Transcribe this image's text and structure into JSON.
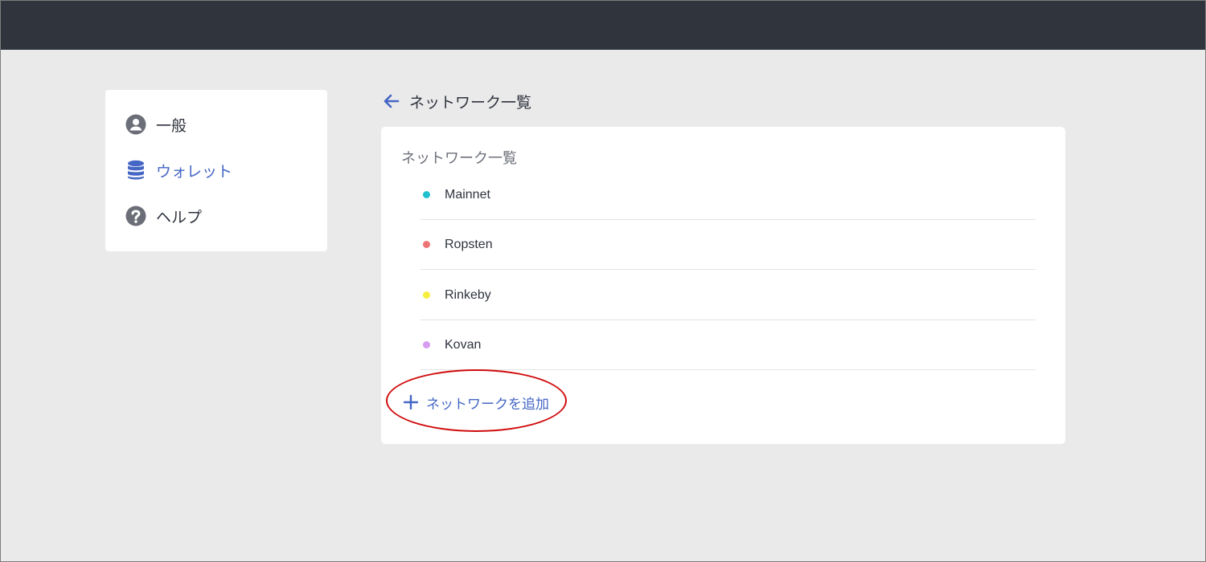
{
  "sidebar": {
    "items": [
      {
        "label": "一般",
        "icon": "user-circle-icon",
        "active": false
      },
      {
        "label": "ウォレット",
        "icon": "database-icon",
        "active": true
      },
      {
        "label": "ヘルプ",
        "icon": "question-circle-icon",
        "active": false
      }
    ]
  },
  "header": {
    "back_icon": "arrow-left-icon",
    "title": "ネットワーク一覧"
  },
  "card": {
    "title": "ネットワーク一覧",
    "networks": [
      {
        "name": "Mainnet",
        "color": "#1fbfd0"
      },
      {
        "name": "Ropsten",
        "color": "#ec7474"
      },
      {
        "name": "Rinkeby",
        "color": "#f6ee3e"
      },
      {
        "name": "Kovan",
        "color": "#d79cf0"
      }
    ],
    "add_label": "ネットワークを追加",
    "add_icon": "plus-icon"
  },
  "colors": {
    "accent": "#4566c4",
    "topbar": "#30343d",
    "background": "#eaeaea",
    "highlight": "#d10c0c"
  }
}
